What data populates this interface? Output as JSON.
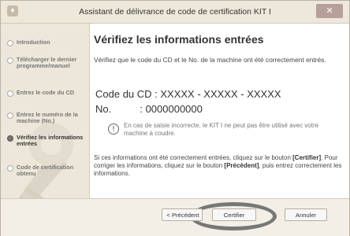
{
  "window": {
    "title": "Assistant de délivrance de code de certification KIT I",
    "close_label": "✕"
  },
  "sidebar": {
    "items": [
      {
        "label": "Introduction"
      },
      {
        "label": "Télécharger le dernier programme/manuel"
      },
      {
        "label": "Entrez le code du CD"
      },
      {
        "label": "Entrez le numéro de la machine (No.)"
      },
      {
        "label": "Vérifiez les informations entrées",
        "active": true
      },
      {
        "label": "Code de certification obtenu"
      }
    ]
  },
  "main": {
    "heading": "Vérifiez les informations entrées",
    "intro": "Vérifiez que le code du CD et le No. de la machine ont été correctement entrés.",
    "cd_code_line": "Code du CD : XXXXX - XXXXX - XXXXX",
    "machine_no_line": "No.          : 0000000000",
    "note_icon": "!",
    "note_text": "En cas de saisie incorrecte, le KIT I ne peut pas être utilisé avec votre machine à coudre.",
    "instruction_part1": "Si ces informations ont été correctement entrées, cliquez sur le bouton ",
    "instruction_button1": "[Certifier]",
    "instruction_part2": ". Pour corriger les informations, cliquez sur le bouton ",
    "instruction_button2": "[Précédent]",
    "instruction_part3": ", puis entrez correctement les informations."
  },
  "footer": {
    "previous_button": "< Précédent",
    "certify_button": "Certifier",
    "cancel_button": "Annuler"
  }
}
